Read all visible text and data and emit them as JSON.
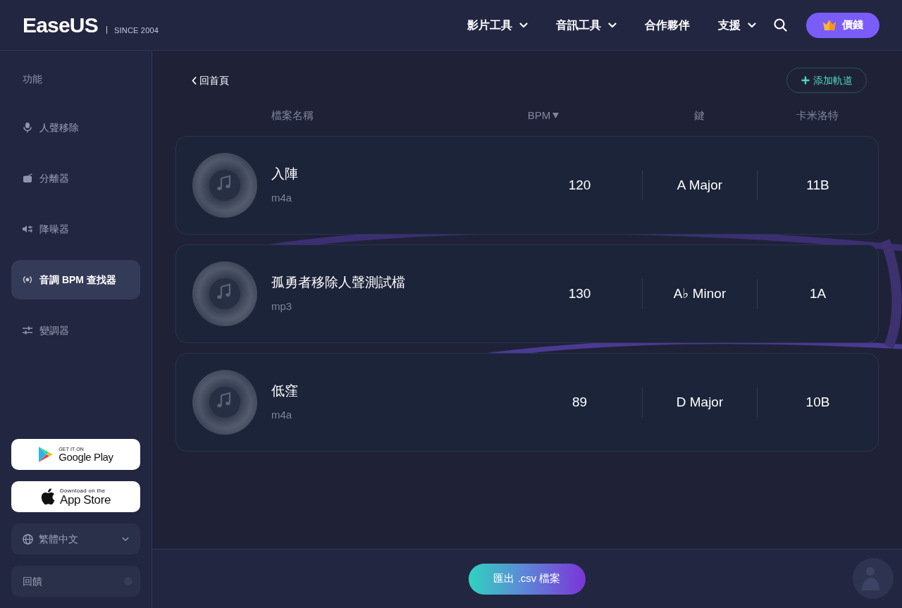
{
  "header": {
    "logo": "EaseUS",
    "tagline": "SINCE 2004",
    "nav": [
      {
        "label": "影片工具",
        "dropdown": true
      },
      {
        "label": "音訊工具",
        "dropdown": true
      },
      {
        "label": "合作夥伴",
        "dropdown": false
      },
      {
        "label": "支援",
        "dropdown": true
      }
    ],
    "pricing_button": "價錢"
  },
  "sidebar": {
    "heading": "功能",
    "items": [
      {
        "label": "人聲移除",
        "kind": "microphone",
        "selected": false
      },
      {
        "label": "分離器",
        "kind": "drum",
        "selected": false
      },
      {
        "label": "降噪器",
        "kind": "noise",
        "selected": false
      },
      {
        "label": "音調 BPM 查找器",
        "kind": "signal",
        "selected": true
      },
      {
        "label": "變調器",
        "kind": "sliders",
        "selected": false
      }
    ],
    "store_badges": [
      {
        "kind": "google-play",
        "caption": "GET IT ON",
        "store": "Google Play"
      },
      {
        "kind": "app-store",
        "caption": "Download on the",
        "store": "App Store"
      }
    ],
    "language": "繁體中文",
    "feedback": "回饋"
  },
  "main": {
    "back_link": "回首頁",
    "add_track_button": "添加軌道",
    "columns": [
      {
        "label": "檔案名稱",
        "sorted": false
      },
      {
        "label": "BPM",
        "sorted": true
      },
      {
        "label": "鍵",
        "sorted": false
      },
      {
        "label": "卡米洛特",
        "sorted": false
      }
    ],
    "tracks": [
      {
        "name": "入陣",
        "format": "m4a",
        "bpm": "120",
        "key": "A Major",
        "camelot": "11B"
      },
      {
        "name": "孤勇者移除人聲測試檔",
        "format": "mp3",
        "bpm": "130",
        "key": "A♭ Minor",
        "camelot": "1A"
      },
      {
        "name": "低窪",
        "format": "m4a",
        "bpm": "89",
        "key": "D Major",
        "camelot": "10B"
      }
    ],
    "export_button": "匯出 .csv 檔案"
  }
}
